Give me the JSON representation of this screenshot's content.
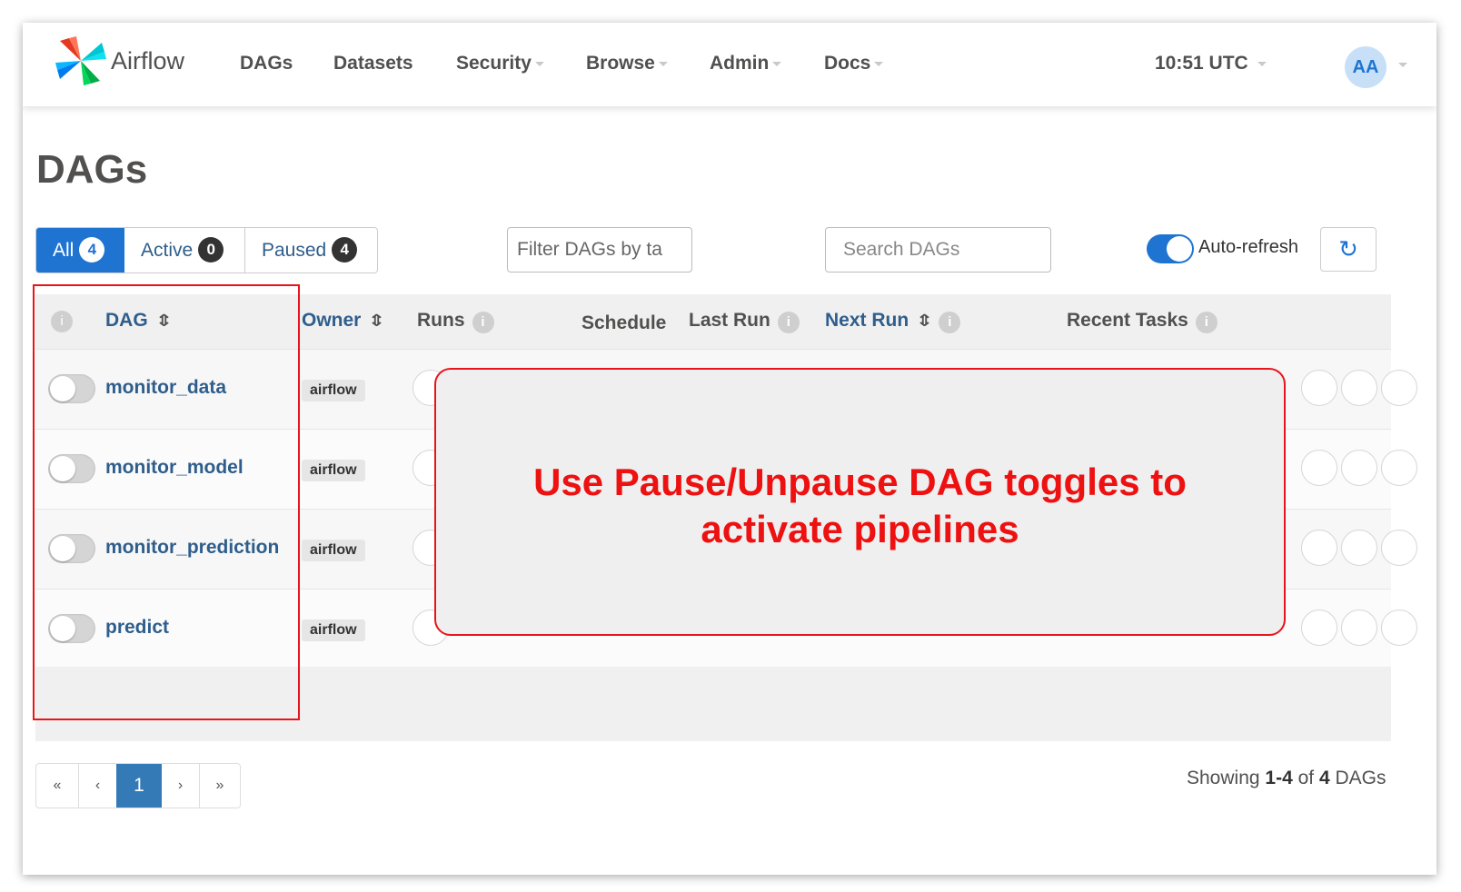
{
  "app": {
    "brand": "Airflow"
  },
  "nav": {
    "items": [
      {
        "label": "DAGs",
        "dropdown": false
      },
      {
        "label": "Datasets",
        "dropdown": false
      },
      {
        "label": "Security",
        "dropdown": true
      },
      {
        "label": "Browse",
        "dropdown": true
      },
      {
        "label": "Admin",
        "dropdown": true
      },
      {
        "label": "Docs",
        "dropdown": true
      }
    ],
    "time": "10:51 UTC",
    "avatar": "AA"
  },
  "page": {
    "title": "DAGs"
  },
  "filters": {
    "all": {
      "label": "All",
      "count": "4"
    },
    "active": {
      "label": "Active",
      "count": "0"
    },
    "paused": {
      "label": "Paused",
      "count": "4"
    },
    "tags_placeholder": "Filter DAGs by ta",
    "search_placeholder": "Search DAGs",
    "auto_refresh_label": "Auto-refresh",
    "auto_refresh_on": true
  },
  "table": {
    "columns": {
      "dag": "DAG",
      "owner": "Owner",
      "runs": "Runs",
      "schedule": "Schedule",
      "last_run": "Last Run",
      "next_run": "Next Run",
      "recent_tasks": "Recent Tasks"
    },
    "rows": [
      {
        "name": "monitor_data",
        "owner": "airflow",
        "paused": true
      },
      {
        "name": "monitor_model",
        "owner": "airflow",
        "paused": true
      },
      {
        "name": "monitor_prediction",
        "owner": "airflow",
        "paused": true
      },
      {
        "name": "predict",
        "owner": "airflow",
        "paused": true
      }
    ]
  },
  "pagination": {
    "first": "«",
    "prev": "‹",
    "current": "1",
    "next": "›",
    "last": "»"
  },
  "summary": {
    "prefix": "Showing ",
    "range": "1-4",
    "of": " of ",
    "total": "4",
    "suffix": " DAGs"
  },
  "annotation": {
    "text": "Use Pause/Unpause DAG toggles to activate pipelines"
  },
  "colors": {
    "accent": "#1f74d2",
    "link": "#2f5e8c",
    "annotation": "#e8141b"
  }
}
